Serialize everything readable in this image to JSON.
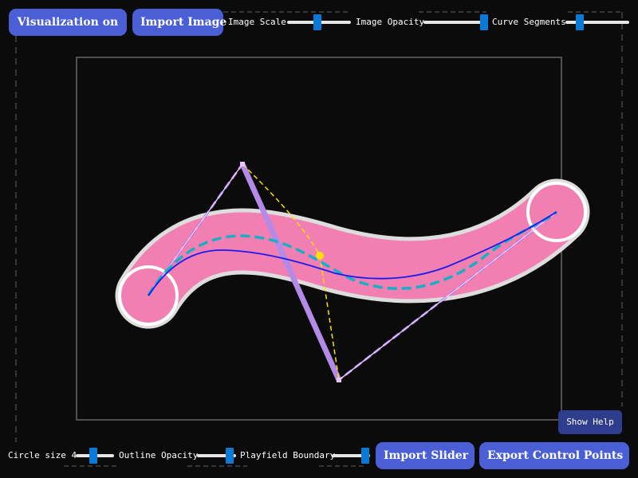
{
  "top_bar": {
    "visualization_button": "Visualization on",
    "import_image_button": "Import Image",
    "image_scale_label": "Image Scale",
    "image_scale_value": 0.47,
    "image_opacity_label": "Image Opacity",
    "image_opacity_value": 0.95,
    "curve_segments_label": "Curve Segments",
    "curve_segments_value": 0.22
  },
  "bottom_bar": {
    "circle_size_label": "Circle size 4",
    "circle_size_value": 0.45,
    "outline_opacity_label": "Outline Opacity",
    "outline_opacity_value": 0.84,
    "playfield_boundary_label": "Playfield Boundary",
    "playfield_boundary_value": 0.88,
    "import_slider_button": "Import Slider",
    "export_button": "Export Control Points"
  },
  "help_button": "Show Help",
  "colors": {
    "background": "#0b0b0b",
    "button": "#4a5fd6",
    "help_button": "#2f3d8f",
    "slider_body": "#f27fb2",
    "slider_border": "#dddddd",
    "curve_center": "#1a1aee",
    "curve_dashed": "#19aec7",
    "control_polygon": "#b48ae8",
    "construction": "#ffe000",
    "slider_thumb": "#0a7ad8"
  }
}
